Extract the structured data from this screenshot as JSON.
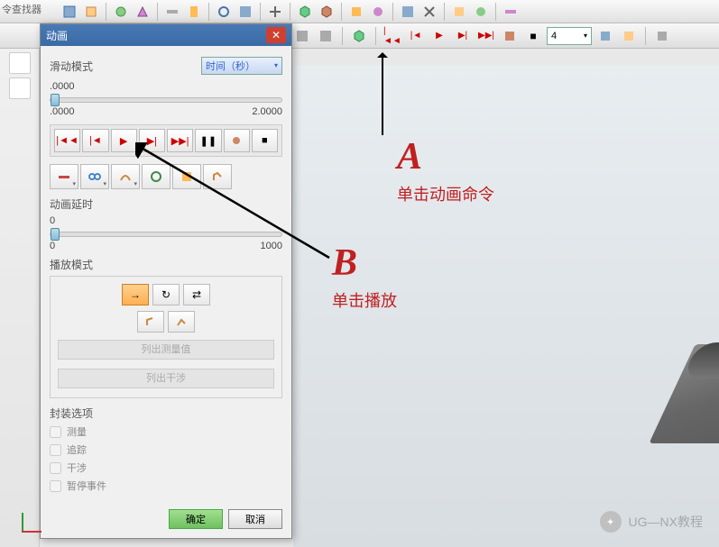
{
  "sidebar_title": "令查找器",
  "toolbar2": {
    "frame_value": "4"
  },
  "dialog": {
    "title": "动画",
    "slide_mode_label": "滑动模式",
    "time_unit": "时间（秒）",
    "slider_min": ".0000",
    "slider_max": "2.0000",
    "delay_label": "动画延时",
    "delay_min": "0",
    "delay_max": "1000",
    "play_mode_label": "播放模式",
    "list_measure_btn": "列出测量值",
    "list_interfere_btn": "列出干涉",
    "package_label": "封装选项",
    "chk_measure": "测量",
    "chk_trace": "追踪",
    "chk_interfere": "干涉",
    "chk_pause": "暂停事件",
    "ok_btn": "确定",
    "cancel_btn": "取消"
  },
  "annotations": {
    "a_letter": "A",
    "a_text": "单击动画命令",
    "b_letter": "B",
    "b_text": "单击播放"
  },
  "watermark": "UG—NX教程"
}
